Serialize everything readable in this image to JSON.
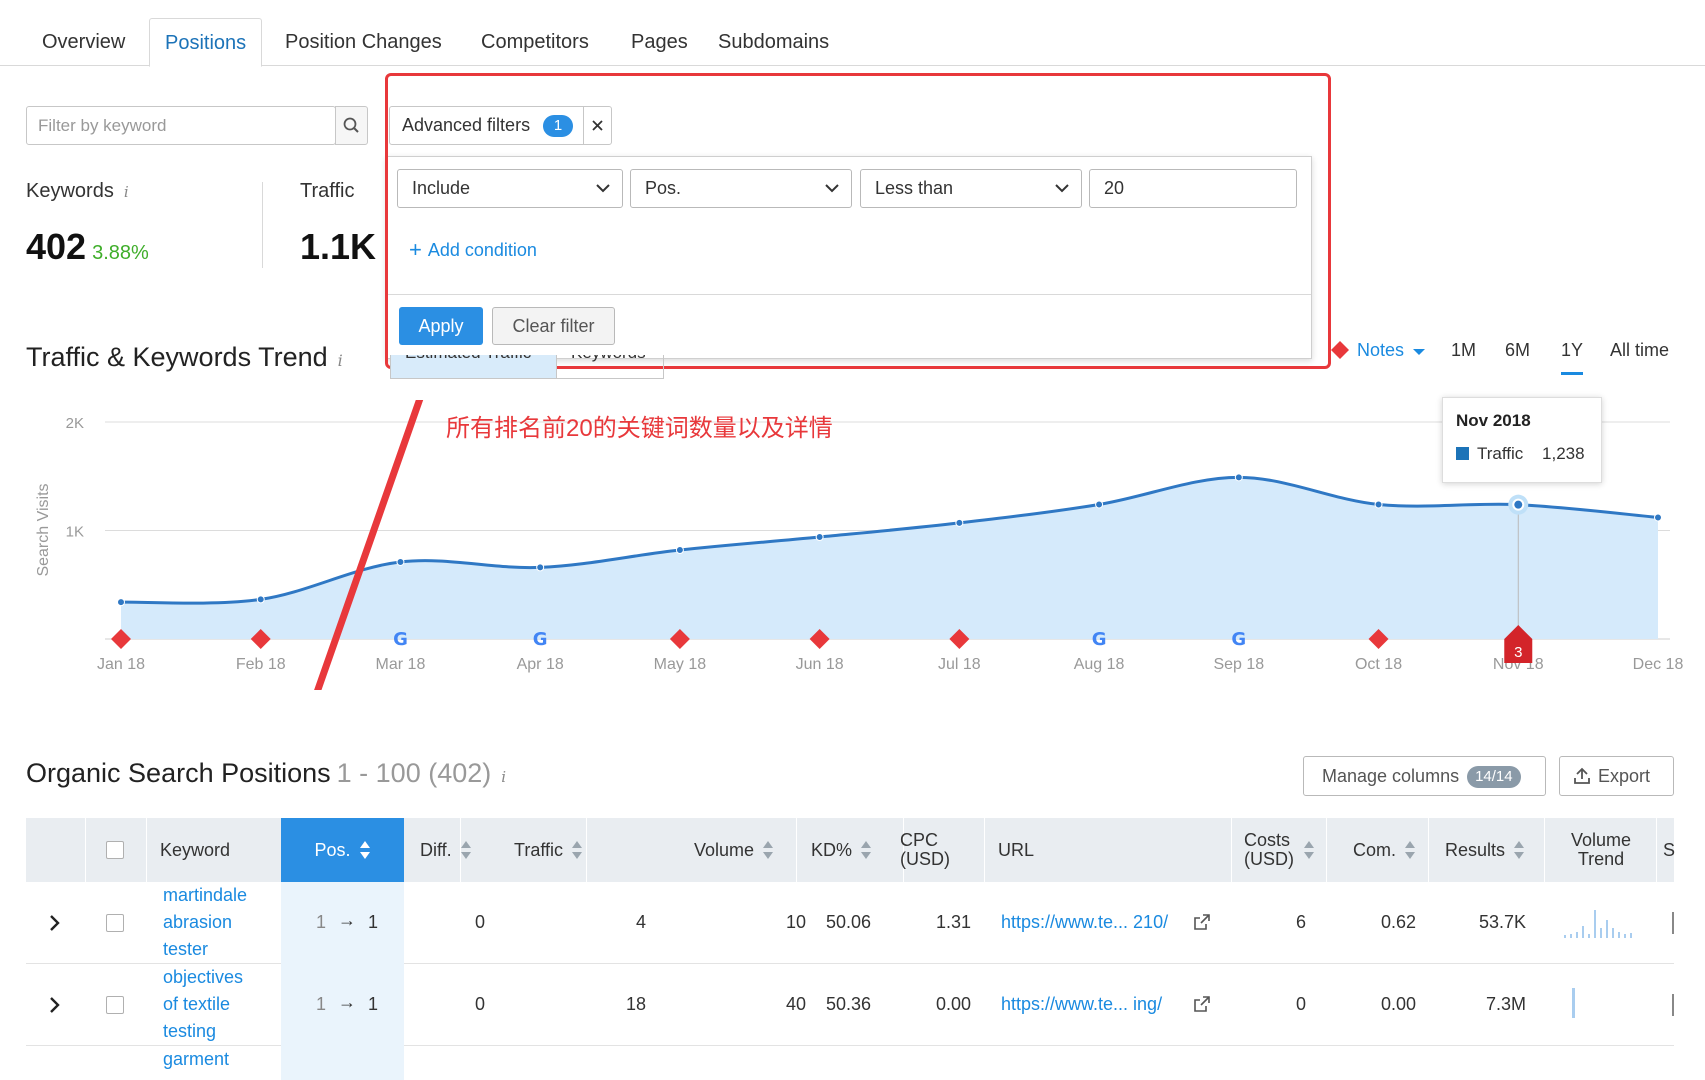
{
  "tabs": [
    "Overview",
    "Positions",
    "Position Changes",
    "Competitors",
    "Pages",
    "Subdomains"
  ],
  "active_tab": "Positions",
  "filter": {
    "placeholder": "Filter by keyword"
  },
  "advanced_filters": {
    "label": "Advanced filters",
    "count": "1",
    "condition": {
      "mode": "Include",
      "field": "Pos.",
      "operator": "Less than",
      "value": "20"
    },
    "add_condition_label": "Add condition",
    "apply_label": "Apply",
    "clear_label": "Clear filter"
  },
  "stats": {
    "keywords_label": "Keywords",
    "keywords_value": "402",
    "keywords_change": "3.88%",
    "traffic_label": "Traffic",
    "traffic_value": "1.1K"
  },
  "trend": {
    "title": "Traffic & Keywords Trend",
    "mini_tabs": [
      "Estimated Traffic",
      "Keywords"
    ],
    "notes_label": "Notes",
    "ranges": [
      "1M",
      "6M",
      "1Y",
      "All time"
    ],
    "active_range": "1Y",
    "tooltip": {
      "title": "Nov 2018",
      "series": "Traffic",
      "value": "1,238"
    },
    "note_badge": "3"
  },
  "annotation": "所有排名前20的关键词数量以及详情",
  "chart_data": {
    "type": "area",
    "ylabel": "Search Visits",
    "yticks": [
      "2K",
      "1K"
    ],
    "ylim": [
      0,
      2000
    ],
    "x": [
      "Jan 18",
      "Feb 18",
      "Mar 18",
      "Apr 18",
      "May 18",
      "Jun 18",
      "Jul 18",
      "Aug 18",
      "Sep 18",
      "Oct 18",
      "Nov 18",
      "Dec 18"
    ],
    "series": [
      {
        "name": "Traffic",
        "values": [
          340,
          365,
          710,
          660,
          820,
          940,
          1070,
          1240,
          1490,
          1240,
          1238,
          1120
        ]
      }
    ],
    "markers": [
      "diamond",
      "diamond",
      "google",
      "google",
      "diamond",
      "diamond",
      "diamond",
      "google",
      "google",
      "diamond",
      "badge",
      "none"
    ],
    "grid": true,
    "colors": {
      "line": "#2f78c4",
      "fill": "#d5eafb",
      "marker": "#e8383b"
    }
  },
  "organic": {
    "title": "Organic Search Positions",
    "range": "1 - 100 (402)",
    "manage_label": "Manage columns",
    "manage_count": "14/14",
    "export_label": "Export",
    "columns": [
      "Keyword",
      "Pos.",
      "Diff.",
      "Traffic",
      "Volume",
      "KD%",
      "CPC (USD)",
      "URL",
      "Costs (USD)",
      "Com.",
      "Results",
      "Volume Trend",
      "S"
    ],
    "rows": [
      {
        "keyword": [
          "martindale",
          "abrasion",
          "tester"
        ],
        "pos_from": "1",
        "pos_to": "1",
        "diff": "0",
        "traffic": "4",
        "volume": "10",
        "kd": "50.06",
        "cpc": "1.31",
        "url": "https://www.te... 210/",
        "costs": "6",
        "com": "0.62",
        "results": "53.7K"
      },
      {
        "keyword": [
          "objectives",
          "of textile",
          "testing"
        ],
        "pos_from": "1",
        "pos_to": "1",
        "diff": "0",
        "traffic": "18",
        "volume": "40",
        "kd": "50.36",
        "cpc": "0.00",
        "url": "https://www.te... ing/",
        "costs": "0",
        "com": "0.00",
        "results": "7.3M"
      },
      {
        "keyword": [
          "garment"
        ]
      }
    ]
  }
}
